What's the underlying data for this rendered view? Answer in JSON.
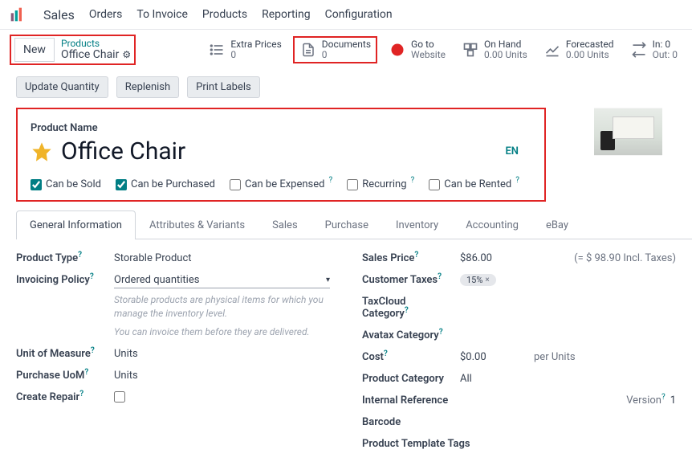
{
  "app_name": "Sales",
  "nav": [
    "Orders",
    "To Invoice",
    "Products",
    "Reporting",
    "Configuration"
  ],
  "new_label": "New",
  "breadcrumb": {
    "parent": "Products",
    "current": "Office Chair"
  },
  "stats": {
    "extra_prices": {
      "label": "Extra Prices",
      "value": "0"
    },
    "documents": {
      "label": "Documents",
      "value": "0"
    },
    "website": {
      "label": "Go to",
      "value": "Website"
    },
    "onhand": {
      "label": "On Hand",
      "value": "0.00 Units"
    },
    "forecasted": {
      "label": "Forecasted",
      "value": "0.00 Units"
    },
    "inout": {
      "in": "In: 0",
      "out": "Out: 0"
    }
  },
  "actions": {
    "update_qty": "Update Quantity",
    "replenish": "Replenish",
    "print_labels": "Print Labels"
  },
  "product": {
    "label": "Product Name",
    "name": "Office Chair",
    "lang": "EN",
    "checks": {
      "sold": "Can be Sold",
      "purchased": "Can be Purchased",
      "expensed": "Can be Expensed",
      "recurring": "Recurring",
      "rented": "Can be Rented"
    }
  },
  "tabs": [
    "General Information",
    "Attributes & Variants",
    "Sales",
    "Purchase",
    "Inventory",
    "Accounting",
    "eBay"
  ],
  "left": {
    "product_type": {
      "label": "Product Type",
      "value": "Storable Product"
    },
    "invoicing_policy": {
      "label": "Invoicing Policy",
      "value": "Ordered quantities"
    },
    "helper1": "Storable products are physical items for which you manage the inventory level.",
    "helper2": "You can invoice them before they are delivered.",
    "uom": {
      "label": "Unit of Measure",
      "value": "Units"
    },
    "purchase_uom": {
      "label": "Purchase UoM",
      "value": "Units"
    },
    "create_repair": {
      "label": "Create Repair"
    }
  },
  "right": {
    "sales_price": {
      "label": "Sales Price",
      "value": "$86.00",
      "incl": "(= $ 98.90 Incl. Taxes)"
    },
    "customer_taxes": {
      "label": "Customer Taxes",
      "value": "15%"
    },
    "taxcloud": {
      "label": "TaxCloud Category"
    },
    "avatax": {
      "label": "Avatax Category"
    },
    "cost": {
      "label": "Cost",
      "value": "$0.00",
      "per": "per Units"
    },
    "category": {
      "label": "Product Category",
      "value": "All"
    },
    "internal_ref": {
      "label": "Internal Reference"
    },
    "version": {
      "label": "Version",
      "value": "1"
    },
    "barcode": {
      "label": "Barcode"
    },
    "template_tags": {
      "label": "Product Template Tags"
    }
  }
}
